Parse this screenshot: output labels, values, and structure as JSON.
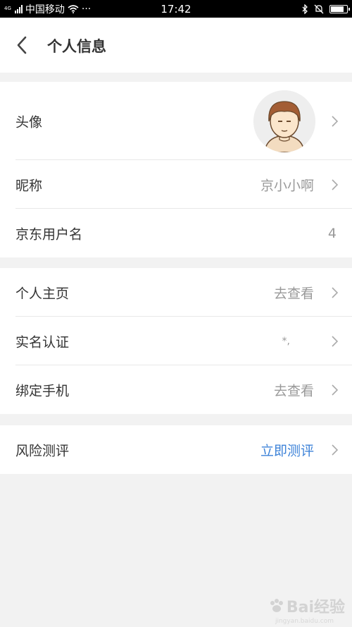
{
  "status_bar": {
    "network_type": "4G",
    "carrier": "中国移动",
    "more": "···",
    "time": "17:42",
    "battery_level": 0.9
  },
  "header": {
    "title": "个人信息"
  },
  "rows": {
    "avatar": {
      "label": "头像"
    },
    "nickname": {
      "label": "昵称",
      "value": "京小小啊"
    },
    "username": {
      "label": "京东用户名",
      "value": "4"
    },
    "homepage": {
      "label": "个人主页",
      "value": "去查看"
    },
    "realname": {
      "label": "实名认证",
      "value": "*,"
    },
    "phone": {
      "label": "绑定手机",
      "value": "去查看"
    },
    "risk": {
      "label": "风险测评",
      "value": "立即测评"
    }
  },
  "colors": {
    "accent": "#3c82d8",
    "background": "#f2f2f2",
    "value_gray": "#999999"
  },
  "watermark": {
    "text": "Bai经验",
    "sub": "jingyan.baidu.com"
  }
}
